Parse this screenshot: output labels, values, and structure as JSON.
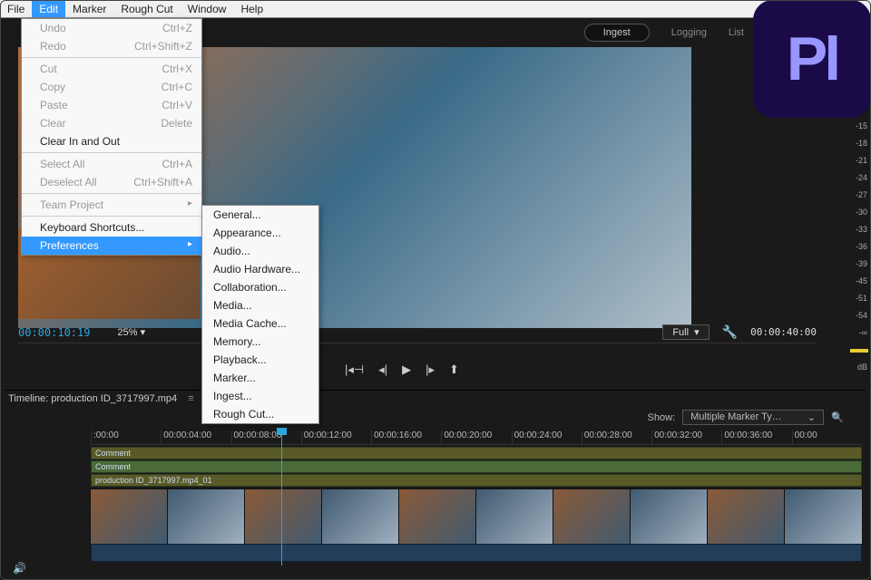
{
  "menubar": [
    "File",
    "Edit",
    "Marker",
    "Rough Cut",
    "Window",
    "Help"
  ],
  "menubar_open_index": 1,
  "edit_menu": [
    {
      "label": "Undo",
      "short": "Ctrl+Z",
      "gray": true
    },
    {
      "label": "Redo",
      "short": "Ctrl+Shift+Z",
      "gray": true
    },
    {
      "sep": true
    },
    {
      "label": "Cut",
      "short": "Ctrl+X",
      "gray": true
    },
    {
      "label": "Copy",
      "short": "Ctrl+C",
      "gray": true
    },
    {
      "label": "Paste",
      "short": "Ctrl+V",
      "gray": true
    },
    {
      "label": "Clear",
      "short": "Delete",
      "gray": true
    },
    {
      "label": "Clear In and Out"
    },
    {
      "sep": true
    },
    {
      "label": "Select All",
      "short": "Ctrl+A",
      "gray": true
    },
    {
      "label": "Deselect All",
      "short": "Ctrl+Shift+A",
      "gray": true
    },
    {
      "sep": true
    },
    {
      "label": "Team Project",
      "arrow": true,
      "gray": true
    },
    {
      "sep": true
    },
    {
      "label": "Keyboard Shortcuts..."
    },
    {
      "label": "Preferences",
      "arrow": true,
      "hi": true
    }
  ],
  "prefs_submenu": [
    "General...",
    "Appearance...",
    "Audio...",
    "Audio Hardware...",
    "Collaboration...",
    "Media...",
    "Media Cache...",
    "Memory...",
    "Playback...",
    "Marker...",
    "Ingest...",
    "Rough Cut..."
  ],
  "topright": {
    "ingest": "Ingest",
    "logging": "Logging",
    "list": "List"
  },
  "logo": "Pl",
  "db": [
    "-15",
    "-18",
    "-21",
    "-24",
    "-27",
    "-30",
    "-33",
    "-36",
    "-39",
    "-45",
    "-51",
    "-54",
    "-∞",
    "dB"
  ],
  "tc": {
    "current": "00:00:10:19",
    "zoom": "25%",
    "full": "Full",
    "duration": "00:00:40:00"
  },
  "transport": {
    "go_in": "|◂⊣",
    "step_back": "◂|",
    "play": "▶",
    "step_fwd": "|▸",
    "export": "⬆"
  },
  "timeline": {
    "panel_label": "Timeline: production ID_3717997.mp4",
    "show": "Show:",
    "marker_type": "Multiple Marker Ty…",
    "chev": "⌄"
  },
  "ruler": [
    ":00:00",
    "00:00:04:00",
    "00:00:08:00",
    "00:00:12:00",
    "00:00:16:00",
    "00:00:20:00",
    "00:00:24:00",
    "00:00:28:00",
    "00:00:32:00",
    "00:00:36:00",
    "00:00"
  ],
  "tracks": {
    "t1": "Comment",
    "t2": "Comment",
    "t3": "production ID_3717997.mp4_01"
  },
  "chev_down": "▾",
  "burger": "≡",
  "speaker": "🔊"
}
